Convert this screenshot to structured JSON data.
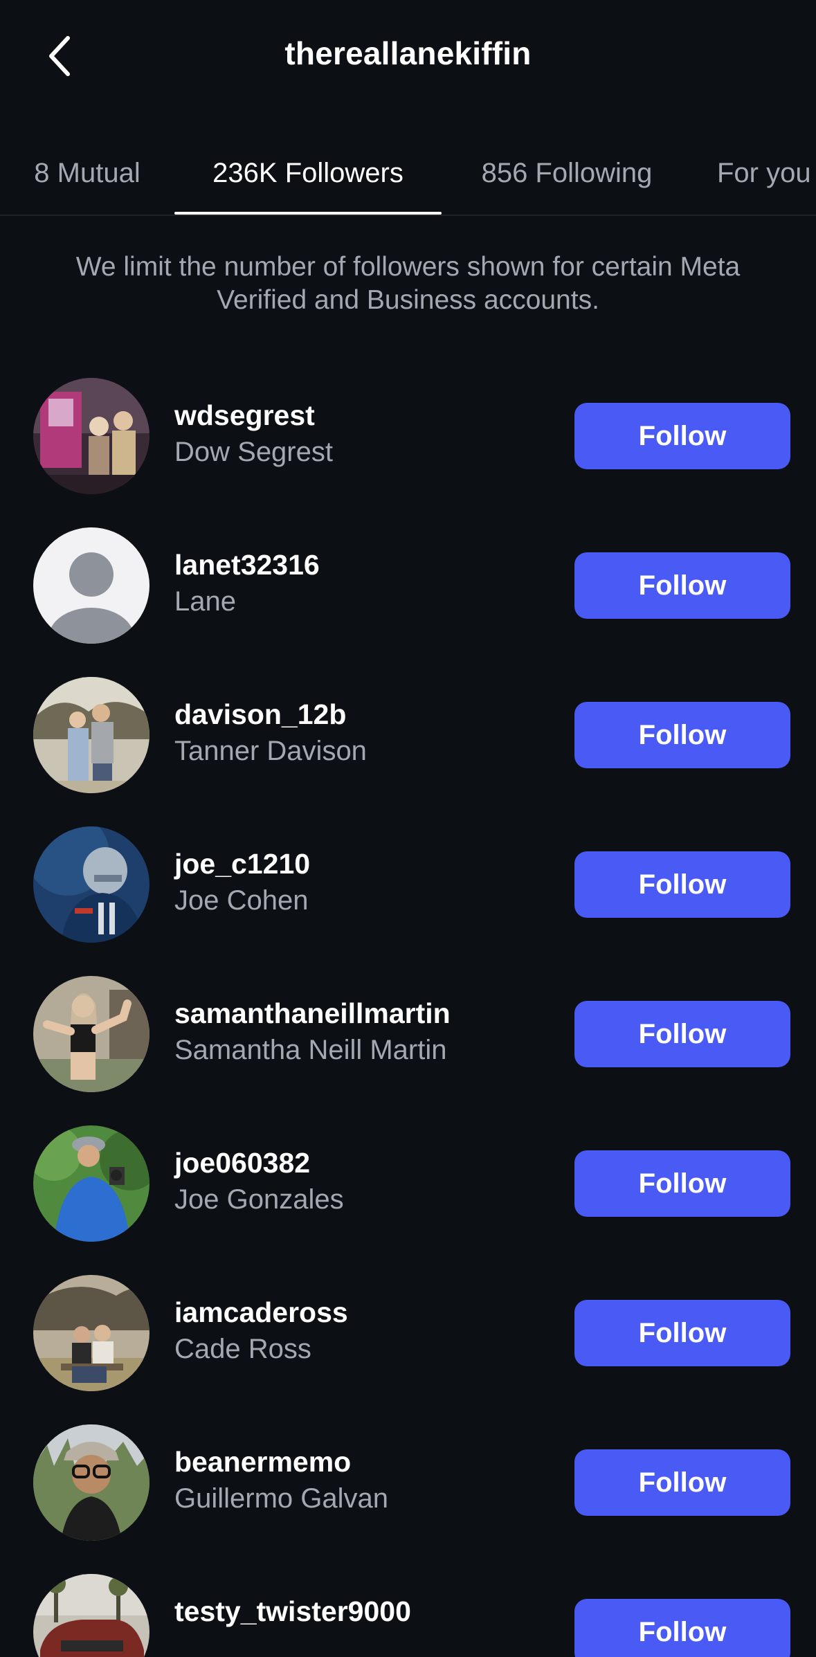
{
  "header": {
    "title": "thereallanekiffin",
    "back_icon": "chevron-left-icon"
  },
  "tabs": [
    {
      "label": "8 Mutual",
      "active": false
    },
    {
      "label": "236K Followers",
      "active": true
    },
    {
      "label": "856 Following",
      "active": false
    },
    {
      "label": "For you",
      "active": false
    }
  ],
  "notice": "We limit the number of followers shown for certain Meta Verified and Business accounts.",
  "followers": [
    {
      "username": "wdsegrest",
      "name": "Dow Segrest",
      "button": "Follow"
    },
    {
      "username": "lanet32316",
      "name": "Lane",
      "button": "Follow"
    },
    {
      "username": "davison_12b",
      "name": "Tanner Davison",
      "button": "Follow"
    },
    {
      "username": "joe_c1210",
      "name": "Joe Cohen",
      "button": "Follow"
    },
    {
      "username": "samanthaneillmartin",
      "name": "Samantha Neill Martin",
      "button": "Follow"
    },
    {
      "username": "joe060382",
      "name": "Joe Gonzales",
      "button": "Follow"
    },
    {
      "username": "iamcadeross",
      "name": "Cade Ross",
      "button": "Follow"
    },
    {
      "username": "beanermemo",
      "name": "Guillermo Galvan",
      "button": "Follow"
    },
    {
      "username": "testy_twister9000",
      "name": "",
      "button": "Follow"
    }
  ],
  "colors": {
    "background": "#0c0f14",
    "follow_button": "#4a5bf5",
    "secondary_text": "#a3a8b1"
  }
}
